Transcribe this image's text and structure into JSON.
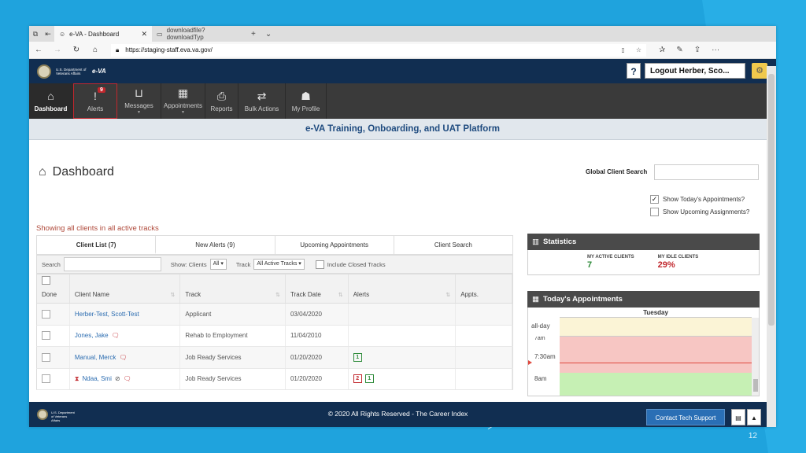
{
  "browser": {
    "tabs": [
      {
        "label": "e-VA - Dashboard"
      },
      {
        "label": "downloadfile?downloadTyp"
      }
    ],
    "url": "https://staging-staff.eva.va.gov/"
  },
  "app": {
    "dept_text": "U.S. Department of Veterans Affairs",
    "brand": "e-VA",
    "help_label": "?",
    "logout_label": "Logout Herber, Sco...",
    "nav": [
      {
        "label": "Dashboard",
        "icon": "home-icon"
      },
      {
        "label": "Alerts",
        "icon": "exclamation-icon",
        "badge": "9"
      },
      {
        "label": "Messages",
        "icon": "inbox-icon"
      },
      {
        "label": "Appointments",
        "icon": "calendar-icon"
      },
      {
        "label": "Reports",
        "icon": "pdf-icon"
      },
      {
        "label": "Bulk Actions",
        "icon": "swap-icon"
      },
      {
        "label": "My Profile",
        "icon": "user-icon"
      }
    ],
    "banner": "e-VA Training, Onboarding, and UAT Platform"
  },
  "dashboard": {
    "title": "Dashboard",
    "global_search_label": "Global Client Search",
    "show_today_appts": "Show Today's Appointments?",
    "show_upcoming": "Show Upcoming Assignments?",
    "showing_text": "Showing all clients in all active tracks",
    "tabs": [
      "Client List (7)",
      "New Alerts (9)",
      "Upcoming Appointments",
      "Client Search"
    ],
    "filters": {
      "search_label": "Search",
      "show_label": "Show: Clients",
      "show_value": "All",
      "track_label": "Track",
      "track_value": "All Active Tracks",
      "include_closed": "Include Closed Tracks"
    },
    "columns": [
      "Done",
      "Client Name",
      "Track",
      "Track Date",
      "Alerts",
      "Appts."
    ],
    "rows": [
      {
        "name": "Herber-Test, Scott-Test",
        "track": "Applicant",
        "date": "03/04/2020",
        "alerts": []
      },
      {
        "name": "Jones, Jake",
        "track": "Rehab to Employment",
        "date": "11/04/2010",
        "alerts": []
      },
      {
        "name": "Manual, Merck",
        "track": "Job Ready Services",
        "date": "01/20/2020",
        "alerts": [
          "1"
        ]
      },
      {
        "name": "Ndaa, Smi",
        "track": "Job Ready Services",
        "date": "01/20/2020",
        "alerts": [
          "2",
          "1"
        ]
      }
    ]
  },
  "statistics": {
    "title": "Statistics",
    "active_label": "MY ACTIVE CLIENTS",
    "active_value": "7",
    "idle_label": "MY IDLE CLIENTS",
    "idle_value": "29%"
  },
  "calendar": {
    "title": "Today's Appointments",
    "day": "Tuesday",
    "allday": "all-day",
    "times": [
      "7am",
      "7:30am",
      "8am"
    ]
  },
  "footer": {
    "copyright": "© 2020 All Rights Reserved - The Career Index",
    "contact": "Contact Tech Support"
  },
  "slide_number": "12"
}
